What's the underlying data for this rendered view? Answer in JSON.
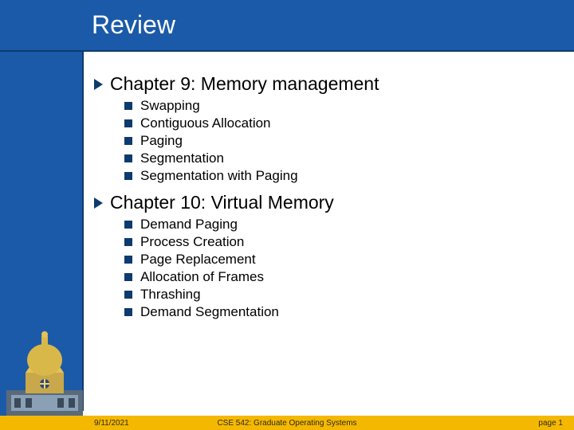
{
  "title": "Review",
  "sections": [
    {
      "heading": "Chapter 9: Memory management",
      "items": [
        "Swapping",
        "Contiguous Allocation",
        "Paging",
        "Segmentation",
        "Segmentation with Paging"
      ]
    },
    {
      "heading": "Chapter 10: Virtual Memory",
      "items": [
        "Demand Paging",
        "Process Creation",
        "Page Replacement",
        "Allocation of Frames",
        "Thrashing",
        "Demand Segmentation"
      ]
    }
  ],
  "footer": {
    "date": "9/11/2021",
    "course": "CSE 542: Graduate Operating Systems",
    "page": "page 1"
  }
}
